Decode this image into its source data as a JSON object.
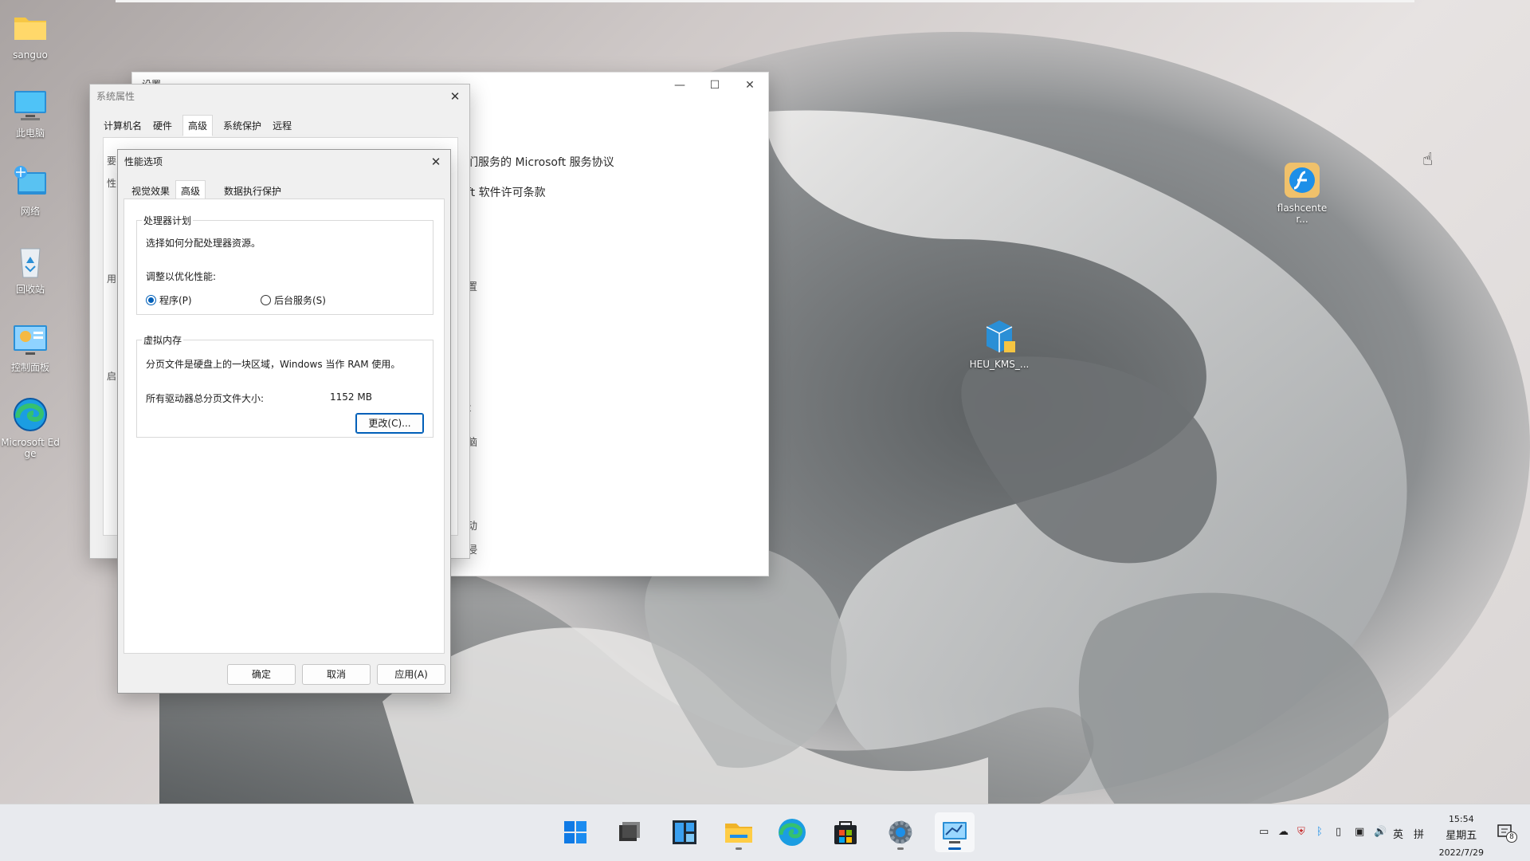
{
  "desktop": {
    "icons": [
      {
        "label": "sanguo",
        "icon": "folder-icon"
      },
      {
        "label": "此电脑",
        "icon": "computer-icon"
      },
      {
        "label": "网络",
        "icon": "network-icon"
      },
      {
        "label": "回收站",
        "icon": "recycle-bin-icon"
      },
      {
        "label": "控制面板",
        "icon": "control-panel-icon"
      },
      {
        "label": "Microsoft Edge",
        "icon": "edge-icon"
      },
      {
        "label": "flashcenter...",
        "icon": "flash-icon"
      },
      {
        "label": "HEU_KMS_...",
        "icon": "kms-icon"
      }
    ]
  },
  "settings_window": {
    "title": "设置",
    "line1": "们服务的 Microsoft 服务协议",
    "line2": "ft 软件许可条款",
    "fragments": [
      "置",
      "t",
      "脑",
      "动",
      "侵"
    ]
  },
  "system_properties": {
    "title": "系统属性",
    "tabs": [
      "计算机名",
      "硬件",
      "高级",
      "系统保护",
      "远程"
    ],
    "active_tab": "高级",
    "partial_labels": [
      "要",
      "性",
      "用",
      "启"
    ]
  },
  "performance_options": {
    "title": "性能选项",
    "tabs": [
      "视觉效果",
      "高级",
      "数据执行保护"
    ],
    "active_tab": "高级",
    "processor_group": {
      "legend": "处理器计划",
      "description": "选择如何分配处理器资源。",
      "adjust_label": "调整以优化性能:",
      "radio_programs": "程序(P)",
      "radio_background": "后台服务(S)",
      "selected": "程序(P)"
    },
    "virtual_memory_group": {
      "legend": "虚拟内存",
      "description": "分页文件是硬盘上的一块区域，Windows 当作 RAM 使用。",
      "total_label": "所有驱动器总分页文件大小:",
      "total_value": "1152 MB",
      "change_button": "更改(C)..."
    },
    "buttons": {
      "ok": "确定",
      "cancel": "取消",
      "apply": "应用(A)"
    }
  },
  "taskbar": {
    "items": [
      "start-icon",
      "task-view-icon",
      "widgets-icon",
      "file-explorer-icon",
      "edge-icon",
      "store-icon",
      "settings-icon",
      "system-properties-icon"
    ],
    "tray": {
      "ime_lang": "英",
      "ime_mode": "拼"
    },
    "clock": {
      "time": "15:54",
      "weekday": "星期五",
      "date": "2022/7/29"
    },
    "notification_count": "8"
  }
}
